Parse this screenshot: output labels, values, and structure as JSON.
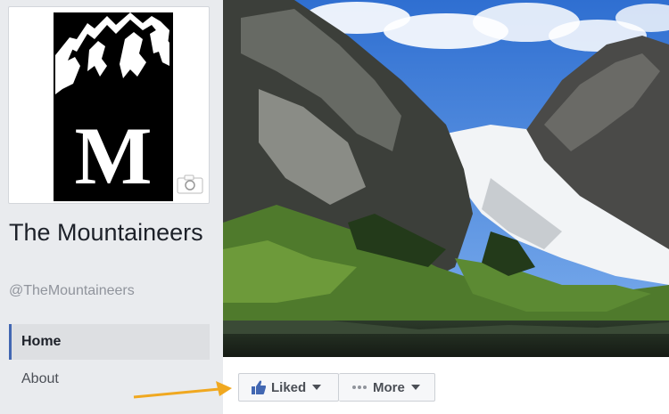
{
  "page": {
    "name": "The Mountaineers",
    "handle": "@TheMountaineers"
  },
  "profile_picture": {
    "logo_letter": "M",
    "camera_icon": "camera-icon"
  },
  "nav": {
    "items": [
      {
        "label": "Home",
        "active": true
      },
      {
        "label": "About",
        "active": false
      }
    ]
  },
  "actions": {
    "liked_label": "Liked",
    "liked_icon": "thumbs-up-icon",
    "more_label": "More",
    "more_icon": "ellipsis-icon"
  },
  "colors": {
    "accent": "#4267b2",
    "arrow": "#f0a820",
    "logo_black": "#000000"
  }
}
